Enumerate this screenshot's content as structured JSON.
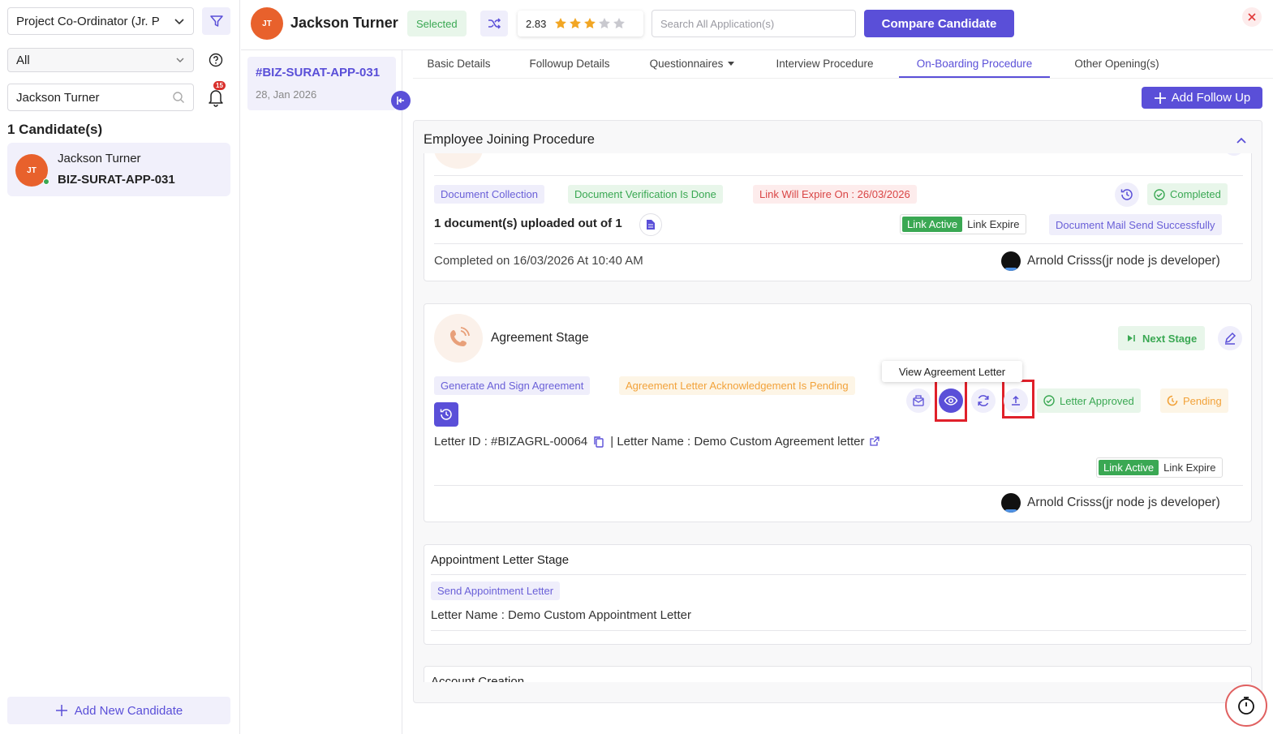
{
  "sidebar": {
    "job_select": "Project Co-Ordinator (Jr. P",
    "status_select": "All",
    "search_value": "Jackson Turner",
    "notification_count": "15",
    "candidates_count_label": "1 Candidate(s)",
    "candidate": {
      "initials": "JT",
      "name": "Jackson Turner",
      "app_id": "BIZ-SURAT-APP-031"
    },
    "add_new_label": "Add New Candidate"
  },
  "header": {
    "initials": "JT",
    "name": "Jackson Turner",
    "status_badge": "Selected",
    "rating": "2.83",
    "rating_stars": 3,
    "search_placeholder": "Search All Application(s)",
    "compare_label": "Compare Candidate"
  },
  "application": {
    "app_id": "#BIZ-SURAT-APP-031",
    "date": "28, Jan 2026"
  },
  "tabs": [
    {
      "label": "Basic Details"
    },
    {
      "label": "Followup Details"
    },
    {
      "label": "Questionnaires"
    },
    {
      "label": "Interview Procedure"
    },
    {
      "label": "On-Boarding Procedure"
    },
    {
      "label": "Other Opening(s)"
    }
  ],
  "add_follow_up_label": "Add Follow Up",
  "panel": {
    "title": "Employee Joining Procedure",
    "doc_stage": {
      "tag_collection": "Document Collection",
      "tag_verification": "Document Verification Is Done",
      "tag_expire": "Link Will Expire On : 26/03/2026",
      "status_completed": "Completed",
      "uploaded_text": "1 document(s) uploaded out of 1",
      "link_active": "Link Active",
      "link_expire": "Link Expire",
      "mail_status": "Document Mail Send Successfully",
      "completed_on": "Completed on 16/03/2026 At 10:40 AM",
      "user": "Arnold Crisss(jr node js developer)"
    },
    "agreement_stage": {
      "title": "Agreement Stage",
      "next_stage_label": "Next Stage",
      "tag_generate": "Generate And Sign Agreement",
      "tag_pending_ack": "Agreement Letter Acknowledgement Is Pending",
      "tooltip": "View Agreement Letter",
      "letter_approved": "Letter Approved",
      "pending": "Pending",
      "letter_id": "Letter ID : #BIZAGRL-00064",
      "letter_name": "| Letter Name : Demo Custom Agreement letter",
      "link_active": "Link Active",
      "link_expire": "Link Expire",
      "user": "Arnold Crisss(jr node js developer)"
    },
    "appointment_stage": {
      "title": "Appointment Letter Stage",
      "tag_send": "Send Appointment Letter",
      "letter_name": "Letter Name : Demo Custom Appointment Letter"
    },
    "account_stage": {
      "title": "Account Creation"
    }
  },
  "colors": {
    "accent": "#5a4fd8",
    "success": "#3aa853",
    "danger": "#d94545",
    "warning": "#f2a23a",
    "avatar": "#e8612c"
  }
}
